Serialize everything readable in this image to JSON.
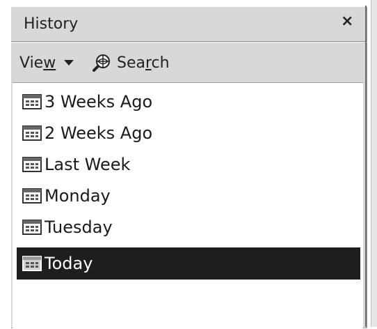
{
  "panel": {
    "title": "History",
    "close_symbol": "×"
  },
  "toolbar": {
    "view_label_pre": "Vie",
    "view_label_accel": "w",
    "search_label_pre": "Sea",
    "search_label_accel": "r",
    "search_label_post": "ch"
  },
  "history": {
    "items": [
      {
        "label": "3 Weeks Ago",
        "icon": "calendar-folder-icon",
        "selected": false
      },
      {
        "label": "2 Weeks Ago",
        "icon": "calendar-folder-icon",
        "selected": false
      },
      {
        "label": "Last Week",
        "icon": "calendar-folder-icon",
        "selected": false
      },
      {
        "label": "Monday",
        "icon": "calendar-folder-icon",
        "selected": false
      },
      {
        "label": "Tuesday",
        "icon": "calendar-folder-icon",
        "selected": false
      },
      {
        "label": "Today",
        "icon": "calendar-folder-icon",
        "selected": true
      }
    ],
    "selected_index": 5
  },
  "colors": {
    "panel_bg": "#d8d8d8",
    "list_bg": "#ffffff",
    "selection_bg": "#1e1e1e",
    "selection_text": "#ffffff"
  }
}
